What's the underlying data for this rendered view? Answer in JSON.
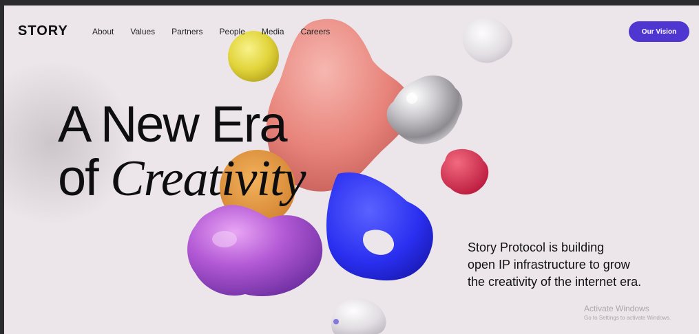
{
  "brand": {
    "logo": "STORY"
  },
  "nav": {
    "items": [
      "About",
      "Values",
      "Partners",
      "People",
      "Media",
      "Careers"
    ],
    "cta": "Our Vision"
  },
  "hero": {
    "line1": "A New Era",
    "line2_plain": "of ",
    "line2_italic": "Creativity"
  },
  "description": {
    "line1": "Story Protocol is building",
    "line2": "open IP infrastructure to grow",
    "line3": "the creativity of the internet era."
  },
  "watermark": {
    "title": "Activate Windows",
    "subtitle": "Go to Settings to activate Windows."
  },
  "colors": {
    "accent": "#5036d1",
    "background": "#ece6ea",
    "text": "#0e0e10"
  }
}
